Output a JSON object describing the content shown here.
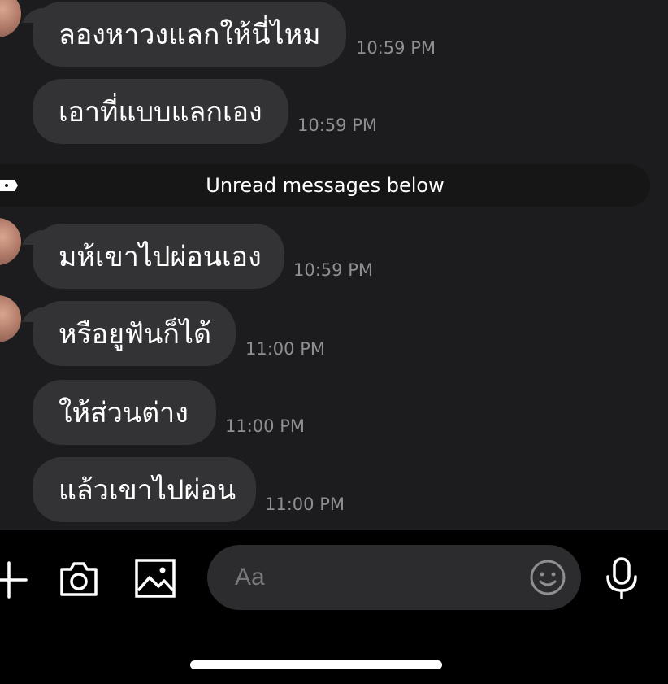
{
  "messages": [
    {
      "text": "ลองหาวงแลกให้นี่ไหม",
      "time": "10:59 PM"
    },
    {
      "text": "เอาที่แบบแลกเอง",
      "time": "10:59 PM"
    },
    {
      "text": "มห้เขาไปผ่อนเอง",
      "time": "10:59 PM"
    },
    {
      "text": "หรือยูฟันก็ได้",
      "time": "11:00 PM"
    },
    {
      "text": "ให้ส่วนต่าง",
      "time": "11:00 PM"
    },
    {
      "text": "แล้วเขาไปผ่อน",
      "time": "11:00 PM"
    }
  ],
  "unread_divider": {
    "label": "Unread messages below"
  },
  "composer": {
    "placeholder": "Aa",
    "icons": [
      "plus-icon",
      "camera-icon",
      "image-icon",
      "emoji-icon",
      "microphone-icon"
    ]
  },
  "colors": {
    "background": "#1c1c1e",
    "bubble": "#333335",
    "timestamp": "#8e8e93",
    "composer_background": "#000000",
    "field": "#2c2c2e"
  }
}
